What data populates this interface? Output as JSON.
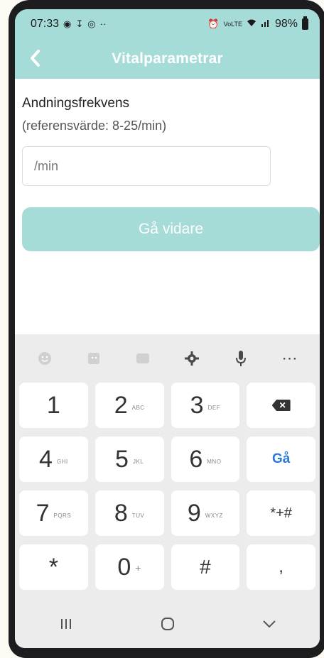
{
  "status_bar": {
    "time": "07:33",
    "left_icons": [
      "message-icon",
      "download-icon",
      "notification-icon",
      "dots-icon"
    ],
    "right_icons": [
      "alarm-icon",
      "volte-icon",
      "wifi-icon",
      "signal-icon"
    ],
    "battery": "98%"
  },
  "app_bar": {
    "title": "Vitalparametrar",
    "back_icon": "chevron-left-icon"
  },
  "form": {
    "label": "Andningsfrekvens",
    "sublabel": "(referensvärde: 8-25/min)",
    "input_placeholder": "/min",
    "input_value": "",
    "submit_label": "Gå vidare"
  },
  "keyboard": {
    "toolbar": [
      "emoji-icon",
      "sticker-icon",
      "gif-icon",
      "settings-icon",
      "mic-icon",
      "more-icon"
    ],
    "rows": [
      [
        {
          "main": "1",
          "sub": ""
        },
        {
          "main": "2",
          "sub": "ABC"
        },
        {
          "main": "3",
          "sub": "DEF"
        },
        {
          "main": "",
          "sub": "",
          "icon": "backspace-icon"
        }
      ],
      [
        {
          "main": "4",
          "sub": "GHI"
        },
        {
          "main": "5",
          "sub": "JKL"
        },
        {
          "main": "6",
          "sub": "MNO"
        },
        {
          "main": "Gå",
          "sub": ""
        }
      ],
      [
        {
          "main": "7",
          "sub": "PQRS"
        },
        {
          "main": "8",
          "sub": "TUV"
        },
        {
          "main": "9",
          "sub": "WXYZ"
        },
        {
          "main": "*+#",
          "sub": ""
        }
      ],
      [
        {
          "main": "*",
          "sub": ""
        },
        {
          "main": "0",
          "sub": "+"
        },
        {
          "main": "#",
          "sub": ""
        },
        {
          "main": ",",
          "sub": ""
        }
      ]
    ]
  },
  "nav_bar": [
    "recents-icon",
    "home-icon",
    "back-icon"
  ],
  "colors": {
    "accent": "#a6dcd8",
    "go_key": "#2a78d8"
  }
}
